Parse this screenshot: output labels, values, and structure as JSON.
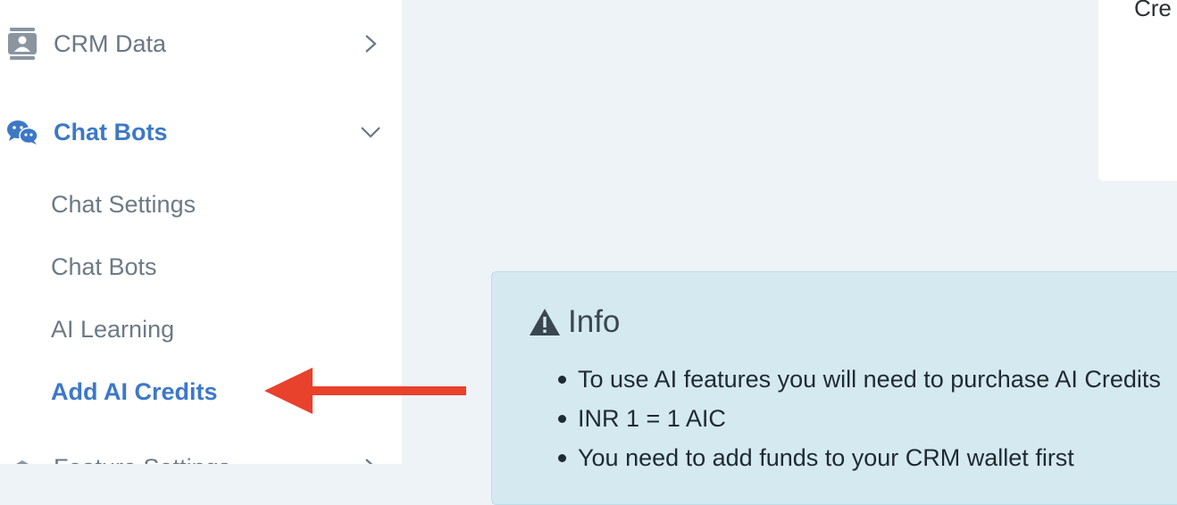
{
  "sidebar": {
    "crm_data": {
      "label": "CRM Data",
      "icon": "contact-card-icon"
    },
    "chat_bots": {
      "label": "Chat Bots",
      "icon": "wechat-chat-icon",
      "expanded": true,
      "children": [
        {
          "label": "Chat Settings",
          "active": false
        },
        {
          "label": "Chat Bots",
          "active": false
        },
        {
          "label": "AI Learning",
          "active": false
        },
        {
          "label": "Add AI Credits",
          "active": true
        }
      ]
    },
    "next_item": {
      "label": "Feature Settings",
      "icon": "settings-icon"
    }
  },
  "card": {
    "text": "Cre"
  },
  "info": {
    "title": "Info",
    "items": [
      "To use AI features you will need to purchase AI Credits",
      "INR 1 = 1 AIC",
      "You need to add funds to your CRM wallet first"
    ]
  },
  "colors": {
    "accent": "#3d78c7",
    "sidebar_text": "#6a7784",
    "info_bg": "#d5e9f0",
    "arrow": "#e8412c",
    "page_bg": "#eef3f8"
  }
}
